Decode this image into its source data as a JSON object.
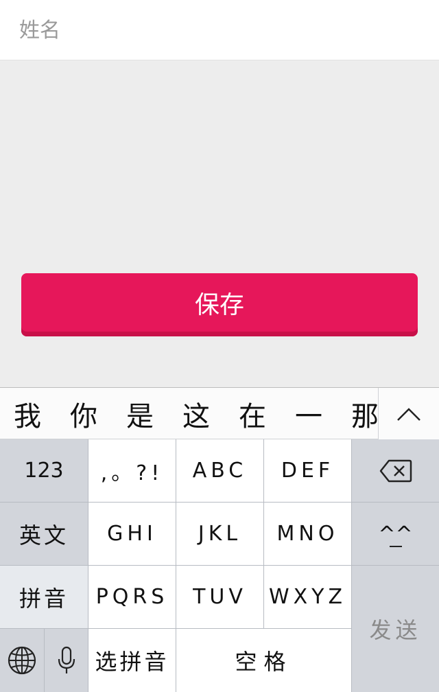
{
  "form": {
    "name_placeholder": "姓名",
    "name_value": ""
  },
  "save_button": {
    "label": "保存"
  },
  "keyboard": {
    "candidates": [
      "我",
      "你",
      "是",
      "这",
      "在",
      "一",
      "那"
    ],
    "expand_icon": "chevron-up-icon",
    "row1": {
      "numbers": "123",
      "punct": ",。?!",
      "abc": "ABC",
      "def": "DEF",
      "delete_icon": "backspace-icon"
    },
    "row2": {
      "english": "英文",
      "ghi": "GHI",
      "jkl": "JKL",
      "mno": "MNO",
      "emoticon": "^^"
    },
    "row3": {
      "pinyin": "拼音",
      "pqrs": "PQRS",
      "tuv": "TUV",
      "wxyz": "WXYZ"
    },
    "row4": {
      "globe_icon": "globe-icon",
      "mic_icon": "microphone-icon",
      "select_pinyin": "选拼音",
      "space": "空格"
    },
    "send": "发送"
  },
  "colors": {
    "save_button": "#e6175a",
    "keyboard_bg": "#d2d5db",
    "key_white": "#ffffff"
  }
}
